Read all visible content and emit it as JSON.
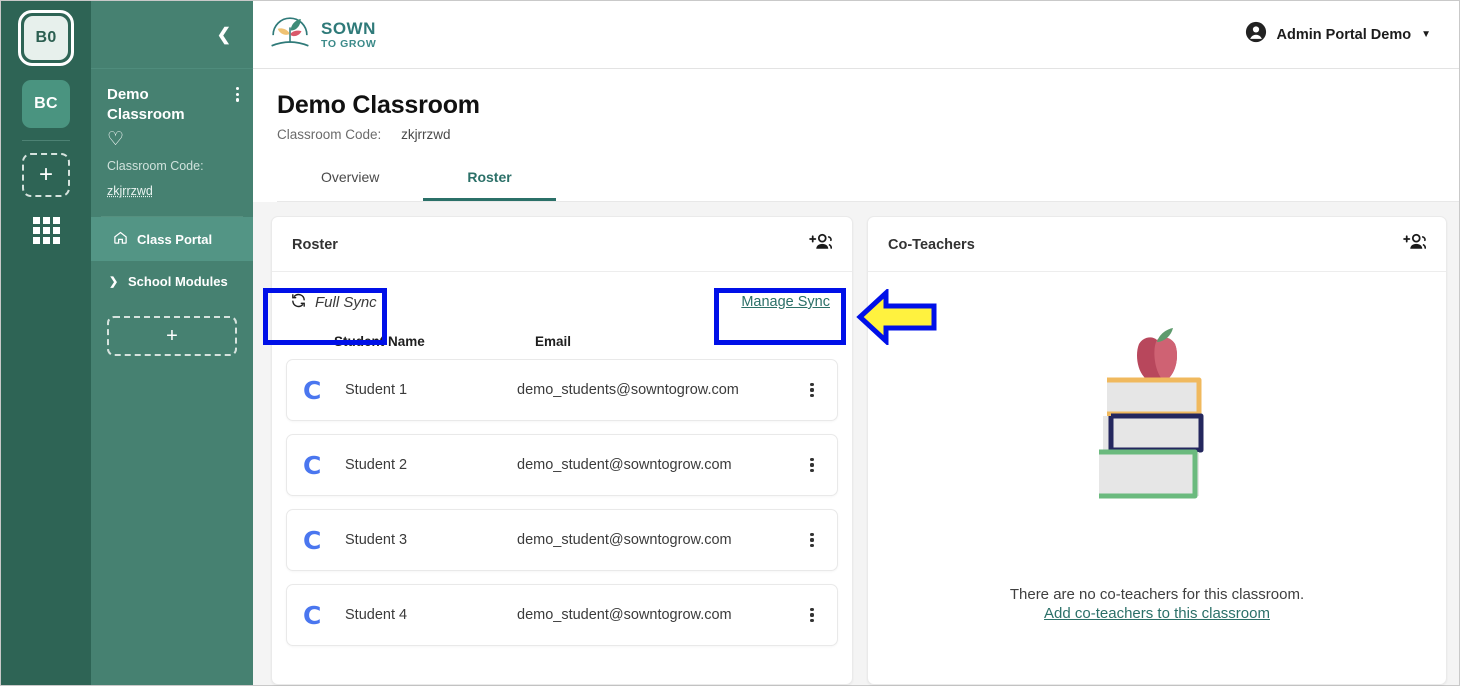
{
  "rail": {
    "tiles": [
      {
        "label": "B0",
        "state": "selected"
      },
      {
        "label": "BC",
        "state": "normal"
      }
    ],
    "add_label": "+",
    "grid_icon": "apps-grid-icon"
  },
  "sidebar": {
    "collapse_icon": "chevron-left-icon",
    "classroom_name": "Demo Classroom",
    "kebab_icon": "kebab-menu-icon",
    "favorite_icon": "heart-icon",
    "code_label": "Classroom Code:",
    "code_value": "zkjrrzwd",
    "items": [
      {
        "label": "Class Portal",
        "icon": "home-icon",
        "active": true
      },
      {
        "label": "School Modules",
        "icon": "chevron-right-icon",
        "active": false
      }
    ],
    "add_label": "+"
  },
  "topbar": {
    "brand_line1": "SOWN",
    "brand_line2": "TO GROW",
    "brand_icon": "sown-to-grow-logo",
    "user_icon": "account-circle-icon",
    "user_name": "Admin Portal Demo",
    "caret_icon": "chevron-down-icon"
  },
  "page": {
    "title": "Demo Classroom",
    "code_label": "Classroom Code:",
    "code_value": "zkjrrzwd",
    "tabs": [
      {
        "label": "Overview",
        "active": false
      },
      {
        "label": "Roster",
        "active": true
      }
    ]
  },
  "roster_card": {
    "title": "Roster",
    "add_icon": "person-add-icon",
    "full_sync_label": "Full Sync",
    "full_sync_icon": "sync-refresh-icon",
    "manage_sync_label": "Manage Sync",
    "columns": [
      "Student Name",
      "Email"
    ],
    "rows": [
      {
        "avatar": "C",
        "name": "Student 1",
        "email": "demo_students@sowntogrow.com",
        "menu_icon": "kebab-menu-icon"
      },
      {
        "avatar": "C",
        "name": "Student 2",
        "email": "demo_student@sowntogrow.com",
        "menu_icon": "kebab-menu-icon"
      },
      {
        "avatar": "C",
        "name": "Student 3",
        "email": "demo_student@sowntogrow.com",
        "menu_icon": "kebab-menu-icon"
      },
      {
        "avatar": "C",
        "name": "Student 4",
        "email": "demo_student@sowntogrow.com",
        "menu_icon": "kebab-menu-icon"
      }
    ]
  },
  "coteachers_card": {
    "title": "Co-Teachers",
    "add_icon": "person-add-icon",
    "illustration": "apple-on-books-illustration",
    "empty_text": "There are no co-teachers for this classroom.",
    "empty_link": "Add co-teachers to this classroom"
  },
  "annotations": {
    "box_color": "#0010e8",
    "arrow_fill": "#fff23f",
    "arrow_stroke": "#0010e8",
    "highlighted": [
      "Full Sync",
      "Manage Sync"
    ]
  },
  "colors": {
    "rail_bg": "#2e6455",
    "sidebar_bg": "#468171",
    "sidebar_active": "#539585",
    "accent_teal": "#2b7068",
    "avatar_blue": "#4a76ef",
    "page_bg": "#f4f4f4"
  }
}
